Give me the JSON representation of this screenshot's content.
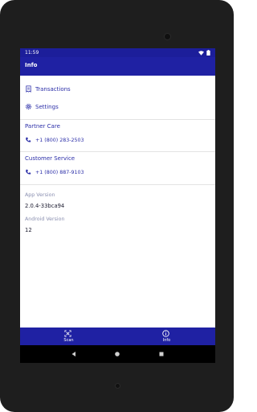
{
  "statusbar": {
    "time": "11:59"
  },
  "appbar": {
    "title": "Info"
  },
  "menu": {
    "transactions_label": "Transactions",
    "settings_label": "Settings"
  },
  "partner_care": {
    "title": "Partner Care",
    "phone": "+1 (800) 283-2503"
  },
  "customer_service": {
    "title": "Customer Service",
    "phone": "+1 (800) 887-9103"
  },
  "app_info": {
    "app_version_label": "App Version",
    "app_version_value": "2.0.4-33bca94",
    "android_version_label": "Android Version",
    "android_version_value": "12"
  },
  "bottom_nav": {
    "items": [
      {
        "label": "Scan",
        "icon": "scan-icon"
      },
      {
        "label": "Info",
        "icon": "info-icon"
      }
    ],
    "active": "Info"
  },
  "colors": {
    "primary": "#1f21a3",
    "accent_text": "#2b2ea8",
    "muted_text": "#8a8fb0"
  }
}
